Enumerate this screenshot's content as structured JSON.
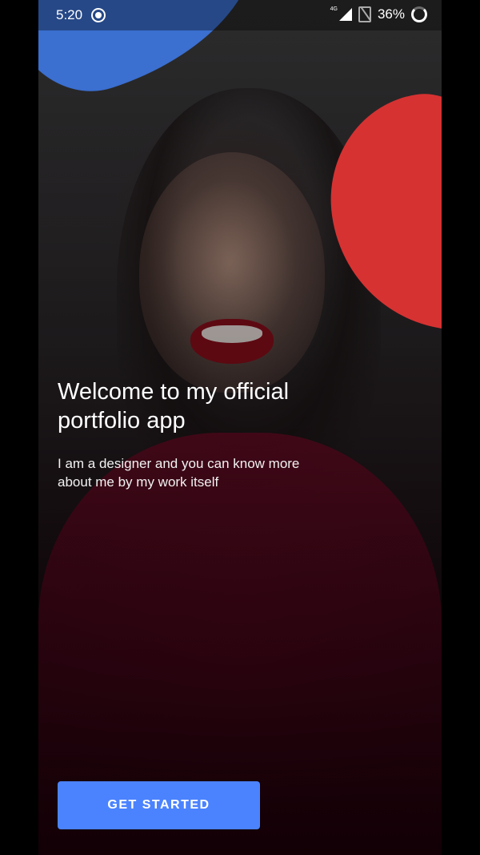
{
  "status_bar": {
    "time": "5:20",
    "network": "4G",
    "battery": "36%",
    "icons": [
      "screen-record-icon",
      "signal-icon",
      "no-sim-icon",
      "battery-icon"
    ]
  },
  "onboarding": {
    "title": "Welcome to my official portfolio app",
    "subtitle": "I am a designer and you can know more about me by my work itself",
    "cta_label": "GET STARTED"
  },
  "colors": {
    "accent_blue": "#4b83ff",
    "blob_blue": "#3b6fd0",
    "blob_red": "#d63232"
  }
}
